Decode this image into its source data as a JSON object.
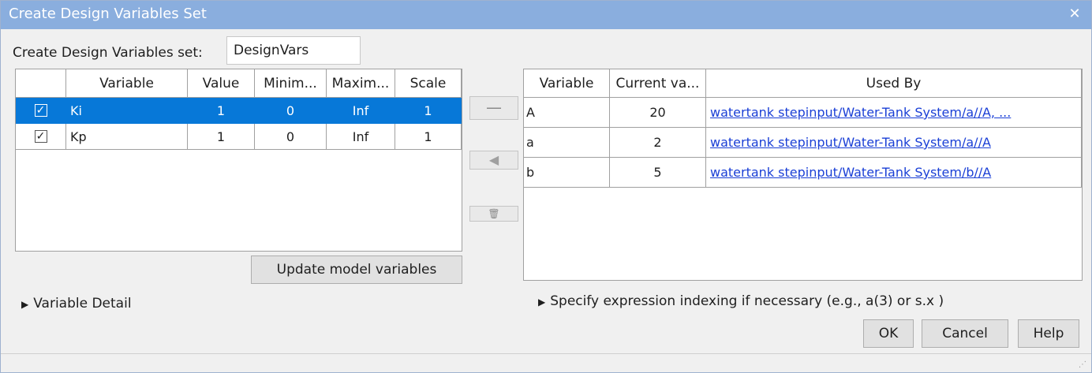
{
  "window": {
    "title": "Create Design Variables Set",
    "close_glyph": "✕"
  },
  "set_name": {
    "label": "Create Design Variables set:",
    "value": "DesignVars"
  },
  "left_table": {
    "headers": [
      "",
      "Variable",
      "Value",
      "Minim...",
      "Maxim...",
      "Scale"
    ],
    "rows": [
      {
        "checked": true,
        "variable": "Ki",
        "value": "1",
        "min": "0",
        "max": "Inf",
        "scale": "1",
        "selected": true
      },
      {
        "checked": true,
        "variable": "Kp",
        "value": "1",
        "min": "0",
        "max": "Inf",
        "scale": "1",
        "selected": false
      }
    ]
  },
  "update_button": "Update model variables",
  "variable_detail": "Variable Detail",
  "middle_buttons": {
    "remove_icon": "remove-icon",
    "add_icon": "arrow-left-icon",
    "delete_icon": "trash-icon"
  },
  "right_table": {
    "headers": [
      "Variable",
      "Current va...",
      "Used By"
    ],
    "rows": [
      {
        "variable": "A",
        "current": "20",
        "used_by": "watertank stepinput/Water-Tank System/a//A, ..."
      },
      {
        "variable": "a",
        "current": "2",
        "used_by": "watertank stepinput/Water-Tank System/a//A"
      },
      {
        "variable": "b",
        "current": "5",
        "used_by": "watertank stepinput/Water-Tank System/b//A"
      }
    ]
  },
  "expression_indexing": "Specify expression indexing if necessary (e.g., a(3) or s.x )",
  "buttons": {
    "ok": "OK",
    "cancel": "Cancel",
    "help": "Help"
  },
  "colors": {
    "titlebar": "#8aaede",
    "selection": "#0778d8",
    "link": "#1a3fd6"
  }
}
